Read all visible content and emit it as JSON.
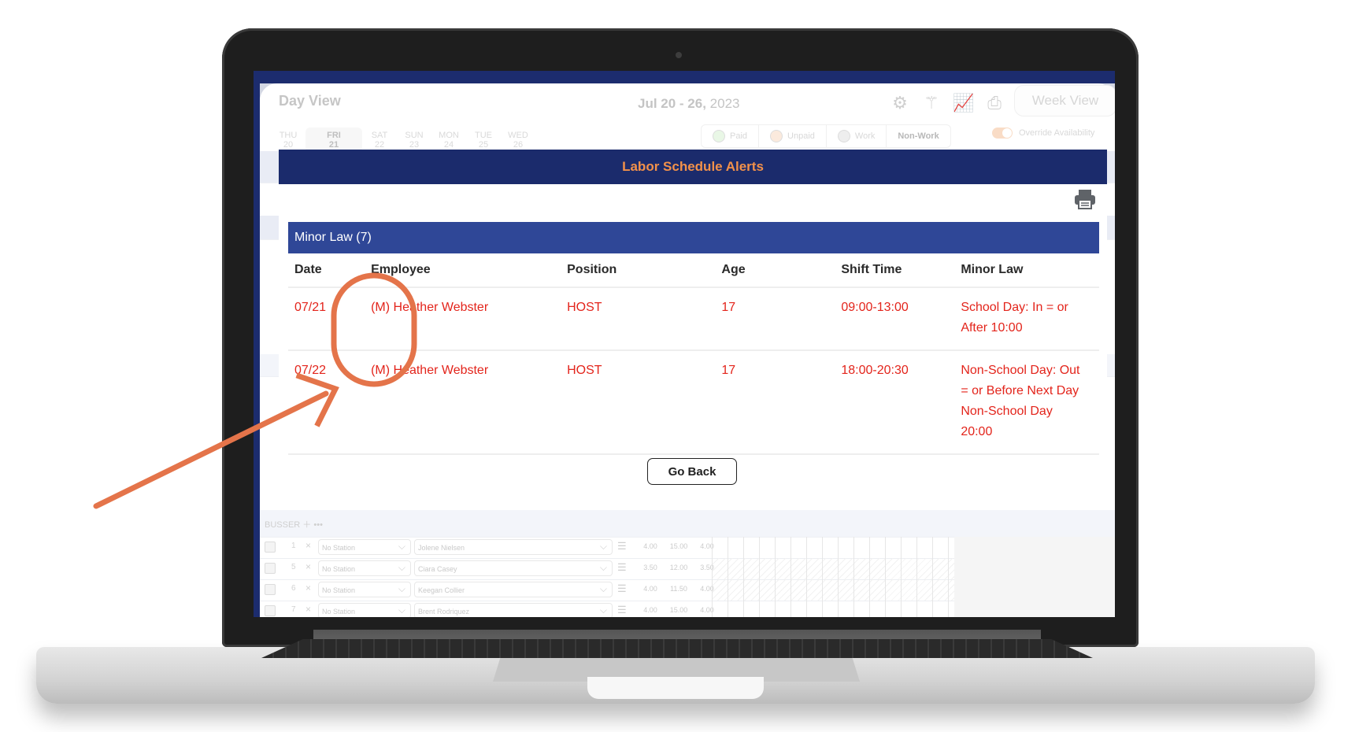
{
  "app": {
    "view_title": "Day View",
    "date_range_bold": "Jul 20 - 26,",
    "date_range_year": " 2023",
    "week_view_label": "Week View",
    "toolbar_icons": [
      "gear-icon",
      "magic-wand-icon",
      "chart-icon",
      "printer-icon"
    ],
    "days": [
      {
        "dow": "THU",
        "day": "20",
        "active": false
      },
      {
        "dow": "FRI",
        "day": "21",
        "active": true
      },
      {
        "dow": "SAT",
        "day": "22",
        "active": false
      },
      {
        "dow": "SUN",
        "day": "23",
        "active": false
      },
      {
        "dow": "MON",
        "day": "24",
        "active": false
      },
      {
        "dow": "TUE",
        "day": "25",
        "active": false
      },
      {
        "dow": "WED",
        "day": "26",
        "active": false
      }
    ],
    "legend": [
      {
        "label": "Paid",
        "color": "#e9f7e6"
      },
      {
        "label": "Unpaid",
        "color": "#fbeadd"
      },
      {
        "label": "Work",
        "color": "#eeeeee"
      },
      {
        "label": "Non-Work",
        "color": null
      }
    ],
    "override_label": "Override Availability",
    "override_on": true,
    "background_section": {
      "label": "BUSSER",
      "rows": [
        {
          "num": "1",
          "station": "No Station",
          "employee": "Jolene Nielsen",
          "v1": "4.00",
          "v2": "15.00",
          "v3": "4.00"
        },
        {
          "num": "5",
          "station": "No Station",
          "employee": "Ciara Casey",
          "v1": "3.50",
          "v2": "12.00",
          "v3": "3.50"
        },
        {
          "num": "6",
          "station": "No Station",
          "employee": "Keegan Collier",
          "v1": "4.00",
          "v2": "11.50",
          "v3": "4.00"
        },
        {
          "num": "7",
          "station": "No Station",
          "employee": "Brent Rodriquez",
          "v1": "4.00",
          "v2": "15.00",
          "v3": "4.00"
        }
      ]
    }
  },
  "modal": {
    "title": "Labor Schedule Alerts",
    "section_title": "Minor Law (7)",
    "columns": [
      "Date",
      "Employee",
      "Position",
      "Age",
      "Shift Time",
      "Minor Law"
    ],
    "rows": [
      {
        "date": "07/21",
        "employee": "(M) Heather Webster",
        "position": "HOST",
        "age": "17",
        "shift": "09:00-13:00",
        "law": "School Day: In = or After 10:00"
      },
      {
        "date": "07/22",
        "employee": "(M) Heather Webster",
        "position": "HOST",
        "age": "17",
        "shift": "18:00-20:30",
        "law": "Non-School Day: Out = or Before Next Day Non-School Day 20:00"
      }
    ],
    "go_back_label": "Go Back"
  },
  "colors": {
    "header_navy": "#1b2b6c",
    "section_blue": "#2f4797",
    "title_orange": "#f2914a",
    "alert_red": "#e3241b",
    "annotation_orange": "#e4744a"
  }
}
